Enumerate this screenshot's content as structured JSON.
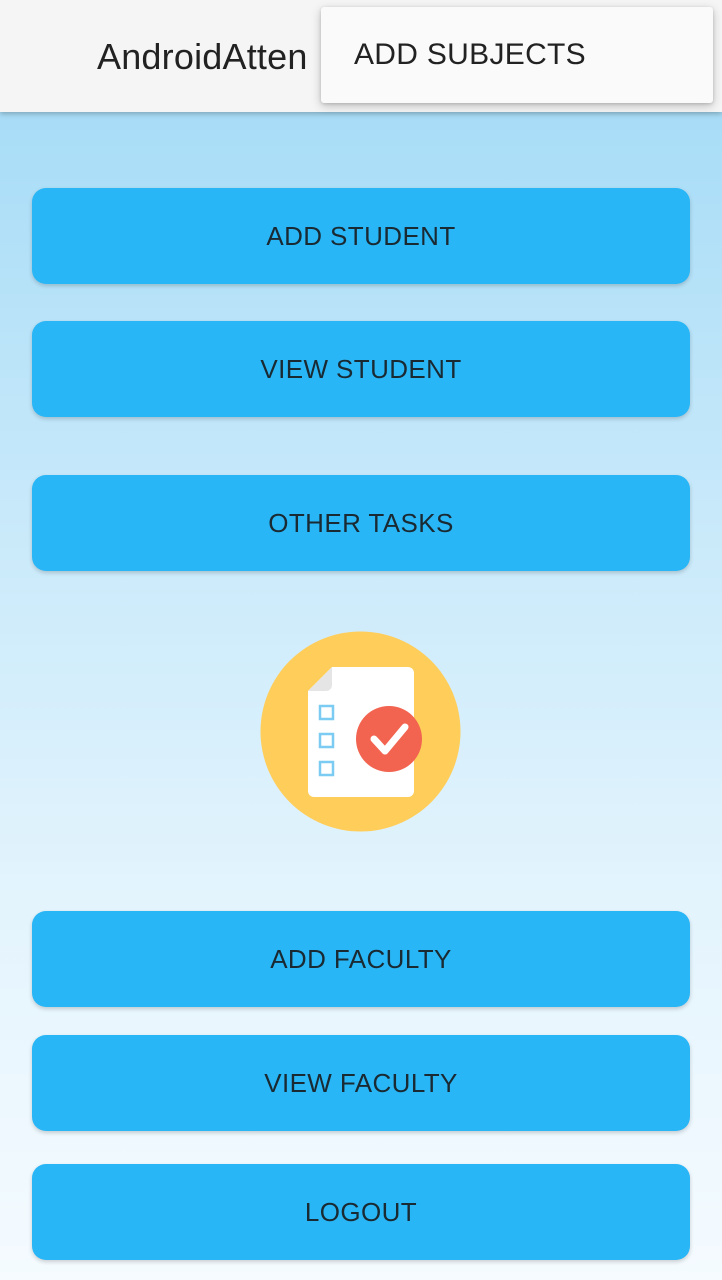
{
  "app_bar": {
    "title": "AndroidAtten"
  },
  "popup_menu": {
    "items": [
      {
        "label": "ADD SUBJECTS"
      }
    ]
  },
  "buttons": {
    "add_student": "ADD STUDENT",
    "view_student": "VIEW STUDENT",
    "other_tasks": "OTHER TASKS",
    "add_faculty": "ADD FACULTY",
    "view_faculty": "VIEW FACULTY",
    "logout": "LOGOUT"
  },
  "illustration": {
    "icon": "attendance-checklist-icon"
  },
  "colors": {
    "button": "#29b6f6",
    "app_bar": "#f5f5f5",
    "background_top": "#9fd9f6",
    "background_bottom": "#f5fbff",
    "illustration_circle": "#ffcd5a",
    "check_badge": "#f26450"
  }
}
